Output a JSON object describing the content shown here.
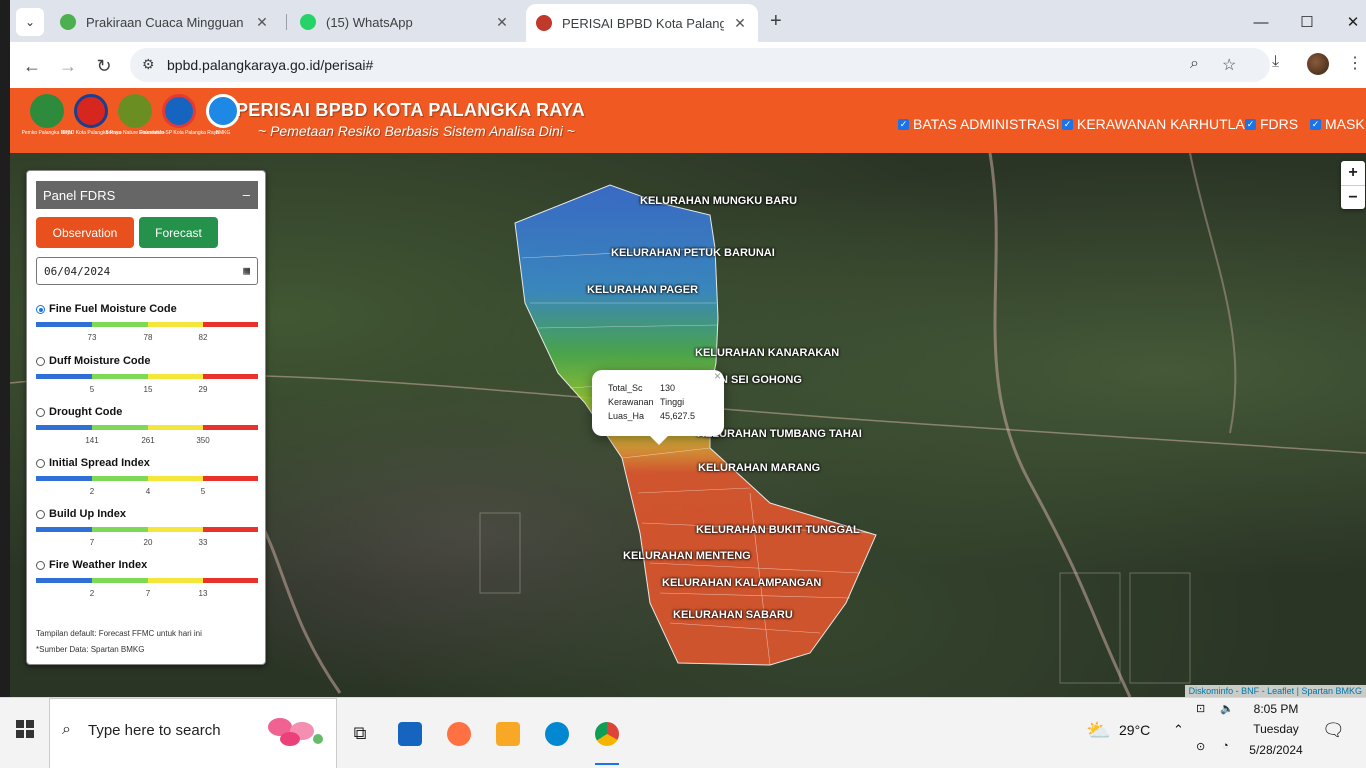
{
  "browser": {
    "tabs": [
      {
        "title": "Prakiraan Cuaca Mingguan | BMKG",
        "fav_color": "#4caf50"
      },
      {
        "title": "(15) WhatsApp",
        "fav_color": "#25d366"
      },
      {
        "title": "PERISAI BPBD Kota Palangka Raya",
        "fav_color": "#c0392b"
      }
    ],
    "new_tab": "+",
    "url": "bpbd.palangkaraya.go.id/perisai#",
    "window": {
      "minimize": "—",
      "maximize": "☐",
      "close": "✕"
    }
  },
  "header": {
    "logos": [
      {
        "caption": "Pemko Palangka Raya",
        "color": "#2e8b3c"
      },
      {
        "caption": "BPBD Kota Palangka Raya",
        "color": "#d7261e"
      },
      {
        "caption": "Borneo Nature Foundation",
        "color": "#6b8e23"
      },
      {
        "caption": "Diskominfo-SP Kota Palangka Raya",
        "color": "#1565c0"
      },
      {
        "caption": "BMKG",
        "color": "#1e88e5"
      }
    ],
    "title": "PERISAI BPBD KOTA PALANGKA RAYA",
    "subtitle": "~ Pemetaan Resiko Berbasis Sistem Analisa Dini ~",
    "layers": [
      "BATAS ADMINISTRASI",
      "KERAWANAN KARHUTLA",
      "FDRS",
      "MASK"
    ]
  },
  "panel": {
    "title": "Panel FDRS",
    "collapse": "–",
    "observation_label": "Observation",
    "forecast_label": "Forecast",
    "date_value": "06/04/2024",
    "indices": [
      {
        "name": "Fine Fuel Moisture Code",
        "selected": true,
        "ticks": [
          "73",
          "78",
          "82"
        ]
      },
      {
        "name": "Duff Moisture Code",
        "selected": false,
        "ticks": [
          "5",
          "15",
          "29"
        ]
      },
      {
        "name": "Drought Code",
        "selected": false,
        "ticks": [
          "141",
          "261",
          "350"
        ]
      },
      {
        "name": "Initial Spread Index",
        "selected": false,
        "ticks": [
          "2",
          "4",
          "5"
        ]
      },
      {
        "name": "Build Up Index",
        "selected": false,
        "ticks": [
          "7",
          "20",
          "33"
        ]
      },
      {
        "name": "Fire Weather Index",
        "selected": false,
        "ticks": [
          "2",
          "7",
          "13"
        ]
      }
    ],
    "scale_colors": [
      "#2f6fd6",
      "#7ed957",
      "#f5e63b",
      "#e8322b"
    ],
    "note": "Tampilan default: Forecast FFMC untuk hari ini",
    "source": "*Sumber Data: Spartan BMKG"
  },
  "map": {
    "labels": [
      "KELURAHAN MUNGKU BARU",
      "KELURAHAN PETUK BARUNAI",
      "KELURAHAN PAGER",
      "KELURAHAN KANARAKAN",
      "N SEI GOHONG",
      "KELURAHAN TUMBANG TAHAI",
      "KELURAHAN MARANG",
      "KELURAHAN BUKIT TUNGGAL",
      "KELURAHAN MENTENG",
      "KELURAHAN KALAMPANGAN",
      "KELURAHAN SABARU"
    ],
    "popup": {
      "close": "×",
      "rows": [
        {
          "key": "Total_Sc",
          "value": "130"
        },
        {
          "key": "Kerawanan",
          "value": "Tinggi"
        },
        {
          "key": "Luas_Ha",
          "value": "45,627.5"
        }
      ]
    },
    "zoom_in": "+",
    "zoom_out": "−",
    "attribution": "Diskominfo - BNF - Leaflet | Spartan BMKG"
  },
  "taskbar": {
    "search_placeholder": "Type here to search",
    "weather_temp": "29°C",
    "time": "8:05 PM",
    "day": "Tuesday",
    "date": "5/28/2024"
  }
}
